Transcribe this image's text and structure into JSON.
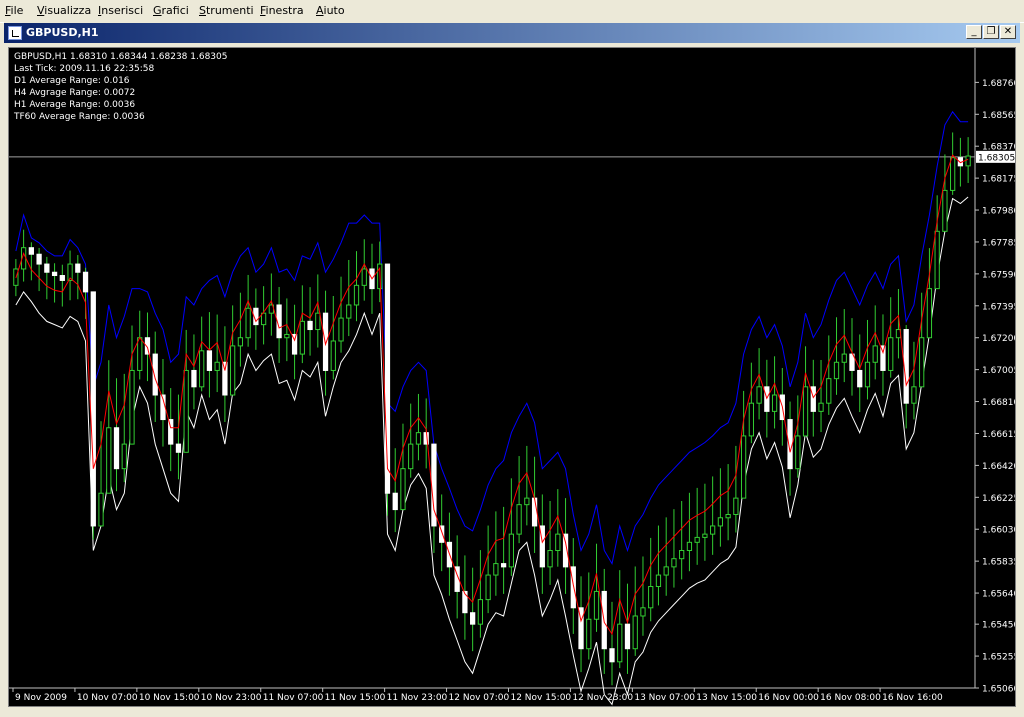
{
  "menu": [
    {
      "pre": "",
      "key": "F",
      "post": "ile"
    },
    {
      "pre": "",
      "key": "V",
      "post": "isualizza"
    },
    {
      "pre": "",
      "key": "I",
      "post": "nserisci"
    },
    {
      "pre": "",
      "key": "G",
      "post": "rafici"
    },
    {
      "pre": "",
      "key": "S",
      "post": "trumenti"
    },
    {
      "pre": "",
      "key": "F",
      "post": "inestra"
    },
    {
      "pre": "",
      "key": "A",
      "post": "iuto"
    }
  ],
  "window": {
    "title": "GBPUSD,H1",
    "minimize": "_",
    "restore": "❐",
    "close": "✕"
  },
  "info": [
    "GBPUSD,H1  1.68310 1.68344 1.68238 1.68305",
    "Last Tick: 2009.11.16 22:35:58",
    "D1 Average Range: 0.016",
    "H4 Avgrage Range: 0.0072",
    "H1 Average Range: 0.0036",
    "TF60 Average Range: 0.0036"
  ],
  "current_price": "1.68305",
  "colors": {
    "bull": "#32cd32",
    "bear": "#ffffff",
    "upper": "#0000ff",
    "lower": "#ffffff",
    "mid": "#ff0000",
    "axis": "#c0c0c0",
    "text": "#ffffff"
  },
  "chart_data": {
    "type": "candlestick",
    "symbol": "GBPUSD",
    "timeframe": "H1",
    "ylim": [
      1.6506,
      1.6897
    ],
    "y_ticks": [
      "1.68760",
      "1.68565",
      "1.68370",
      "1.68175",
      "1.67980",
      "1.67785",
      "1.67590",
      "1.67395",
      "1.67200",
      "1.67005",
      "1.66810",
      "1.66615",
      "1.66420",
      "1.66225",
      "1.66030",
      "1.65835",
      "1.65640",
      "1.65450",
      "1.65255",
      "1.65060"
    ],
    "x_ticks": [
      "9 Nov 2009",
      "10 Nov 07:00",
      "10 Nov 15:00",
      "10 Nov 23:00",
      "11 Nov 07:00",
      "11 Nov 15:00",
      "11 Nov 23:00",
      "12 Nov 07:00",
      "12 Nov 15:00",
      "12 Nov 23:00",
      "13 Nov 07:00",
      "13 Nov 15:00",
      "16 Nov 00:00",
      "16 Nov 08:00",
      "16 Nov 16:00"
    ],
    "x_tick_index": [
      0,
      8,
      16,
      24,
      32,
      40,
      48,
      56,
      64,
      72,
      80,
      88,
      96,
      104,
      112
    ],
    "close": [
      1.6762,
      1.6775,
      1.6771,
      1.6765,
      1.676,
      1.6758,
      1.6755,
      1.6765,
      1.676,
      1.6748,
      1.6605,
      1.6625,
      1.6665,
      1.664,
      1.6655,
      1.67,
      1.672,
      1.671,
      1.6685,
      1.667,
      1.6655,
      1.665,
      1.67,
      1.669,
      1.6712,
      1.67,
      1.6705,
      1.6685,
      1.6715,
      1.672,
      1.6738,
      1.6728,
      1.6735,
      1.674,
      1.672,
      1.6722,
      1.671,
      1.673,
      1.6725,
      1.6735,
      1.67,
      1.6718,
      1.6732,
      1.674,
      1.6752,
      1.6762,
      1.675,
      1.6765,
      1.6625,
      1.6615,
      1.664,
      1.6655,
      1.6662,
      1.6655,
      1.6605,
      1.6595,
      1.658,
      1.6565,
      1.6552,
      1.6545,
      1.656,
      1.6575,
      1.6582,
      1.658,
      1.66,
      1.6618,
      1.6622,
      1.6605,
      1.658,
      1.659,
      1.66,
      1.658,
      1.6555,
      1.653,
      1.6548,
      1.6565,
      1.653,
      1.6522,
      1.6545,
      1.653,
      1.655,
      1.6555,
      1.6568,
      1.6575,
      1.658,
      1.6585,
      1.659,
      1.6595,
      1.6598,
      1.66,
      1.6605,
      1.661,
      1.6612,
      1.6622,
      1.666,
      1.668,
      1.669,
      1.6675,
      1.6685,
      1.667,
      1.664,
      1.666,
      1.669,
      1.6675,
      1.668,
      1.6695,
      1.6705,
      1.671,
      1.67,
      1.669,
      1.6705,
      1.6715,
      1.67,
      1.672,
      1.6725,
      1.668,
      1.669,
      1.672,
      1.675,
      1.6785,
      1.681,
      1.683,
      1.6825,
      1.6831
    ],
    "upper_line": [
      1.6773,
      1.6795,
      1.6781,
      1.6778,
      1.6773,
      1.677,
      1.677,
      1.678,
      1.6775,
      1.6765,
      1.669,
      1.6705,
      1.674,
      1.672,
      1.6733,
      1.675,
      1.675,
      1.6748,
      1.6735,
      1.6725,
      1.6705,
      1.671,
      1.6745,
      1.674,
      1.675,
      1.6755,
      1.6758,
      1.6745,
      1.676,
      1.677,
      1.6775,
      1.676,
      1.6765,
      1.6775,
      1.676,
      1.6762,
      1.6755,
      1.677,
      1.6768,
      1.6778,
      1.676,
      1.6768,
      1.6778,
      1.679,
      1.679,
      1.6795,
      1.679,
      1.679,
      1.668,
      1.6675,
      1.669,
      1.67,
      1.6705,
      1.67,
      1.6655,
      1.664,
      1.6628,
      1.6615,
      1.6605,
      1.6602,
      1.6615,
      1.663,
      1.664,
      1.6645,
      1.6662,
      1.6672,
      1.668,
      1.6668,
      1.664,
      1.6645,
      1.665,
      1.664,
      1.6612,
      1.659,
      1.66,
      1.6618,
      1.659,
      1.6582,
      1.6605,
      1.659,
      1.6605,
      1.6612,
      1.6622,
      1.663,
      1.6635,
      1.664,
      1.6645,
      1.665,
      1.6653,
      1.6656,
      1.666,
      1.6665,
      1.6668,
      1.668,
      1.671,
      1.6725,
      1.6733,
      1.672,
      1.6728,
      1.6715,
      1.669,
      1.6705,
      1.6735,
      1.672,
      1.6728,
      1.6743,
      1.6755,
      1.676,
      1.675,
      1.674,
      1.6752,
      1.676,
      1.675,
      1.6765,
      1.677,
      1.673,
      1.674,
      1.677,
      1.6795,
      1.6825,
      1.685,
      1.6858,
      1.6852,
      1.6852
    ],
    "lower_line": [
      1.674,
      1.6748,
      1.6742,
      1.6735,
      1.673,
      1.6728,
      1.6726,
      1.6733,
      1.673,
      1.6718,
      1.659,
      1.6605,
      1.6635,
      1.6615,
      1.6625,
      1.667,
      1.669,
      1.668,
      1.6655,
      1.664,
      1.6625,
      1.662,
      1.6675,
      1.6665,
      1.6685,
      1.667,
      1.6676,
      1.6655,
      1.6686,
      1.6692,
      1.671,
      1.67,
      1.6706,
      1.671,
      1.6692,
      1.6694,
      1.6682,
      1.67,
      1.6696,
      1.6705,
      1.6672,
      1.669,
      1.6705,
      1.6712,
      1.6722,
      1.6735,
      1.6722,
      1.6735,
      1.66,
      1.659,
      1.6615,
      1.663,
      1.6637,
      1.6628,
      1.6575,
      1.6563,
      1.6548,
      1.6535,
      1.6522,
      1.6515,
      1.653,
      1.6545,
      1.6552,
      1.655,
      1.657,
      1.659,
      1.6595,
      1.6575,
      1.655,
      1.656,
      1.6572,
      1.655,
      1.6526,
      1.6504,
      1.6518,
      1.6534,
      1.6502,
      1.6496,
      1.6515,
      1.6502,
      1.6522,
      1.6528,
      1.654,
      1.6547,
      1.6552,
      1.6557,
      1.6562,
      1.6567,
      1.657,
      1.6572,
      1.6577,
      1.6582,
      1.6585,
      1.6592,
      1.663,
      1.6652,
      1.6662,
      1.6646,
      1.6656,
      1.6641,
      1.661,
      1.663,
      1.6662,
      1.6647,
      1.6652,
      1.6667,
      1.6677,
      1.6683,
      1.6672,
      1.6662,
      1.6676,
      1.6686,
      1.6672,
      1.6692,
      1.6697,
      1.6652,
      1.6662,
      1.6692,
      1.6722,
      1.6758,
      1.6785,
      1.6805,
      1.6802,
      1.6806
    ]
  }
}
